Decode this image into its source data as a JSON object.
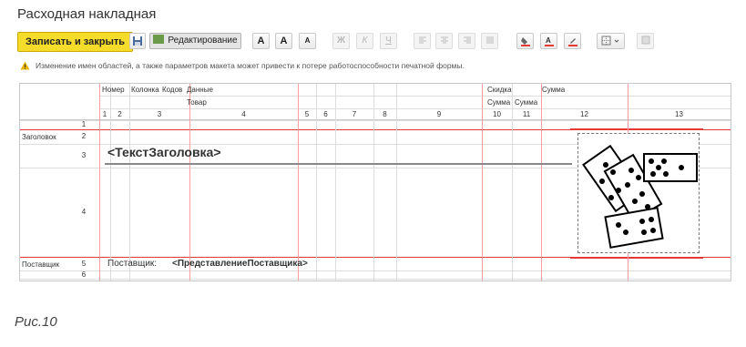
{
  "document": {
    "title": "Расходная накладная"
  },
  "toolbar": {
    "save_close_label": "Записать и закрыть",
    "edit_label": "Редактирование",
    "font_bold_label": "A",
    "font_larger_label": "A",
    "font_smaller_label": "A",
    "italic_label": "Ж",
    "italic2_label": "К",
    "underline_label": "Ч"
  },
  "warning": {
    "text": "Изменение имен областей, а также параметров макета может привести к потере работоспособности печатной формы."
  },
  "grid": {
    "header_row1": [
      "Номер",
      "Колонка",
      "Кодов",
      "Данные",
      "Скидка",
      "Сумма"
    ],
    "header_row2": [
      "Товар",
      "Сумма",
      "Сумма"
    ],
    "column_numbers": [
      "1",
      "2",
      "3",
      "4",
      "5",
      "6",
      "7",
      "8",
      "9",
      "10",
      "11",
      "12",
      "13"
    ],
    "row_numbers": [
      "1",
      "2",
      "3",
      "4",
      "5",
      "6"
    ],
    "area_labels": {
      "header": "Заголовок",
      "supplier": "Поставщик"
    },
    "cells": {
      "title_param": "<ТекстЗаголовка>",
      "supplier_label": "Поставщик:",
      "supplier_param": "<ПредставлениеПоставщика>"
    }
  },
  "figure_caption": "Рис.10",
  "colors": {
    "accent_red": "#e53935",
    "primary_button": "#f5dc2b",
    "warning_icon": "#e8b400"
  }
}
